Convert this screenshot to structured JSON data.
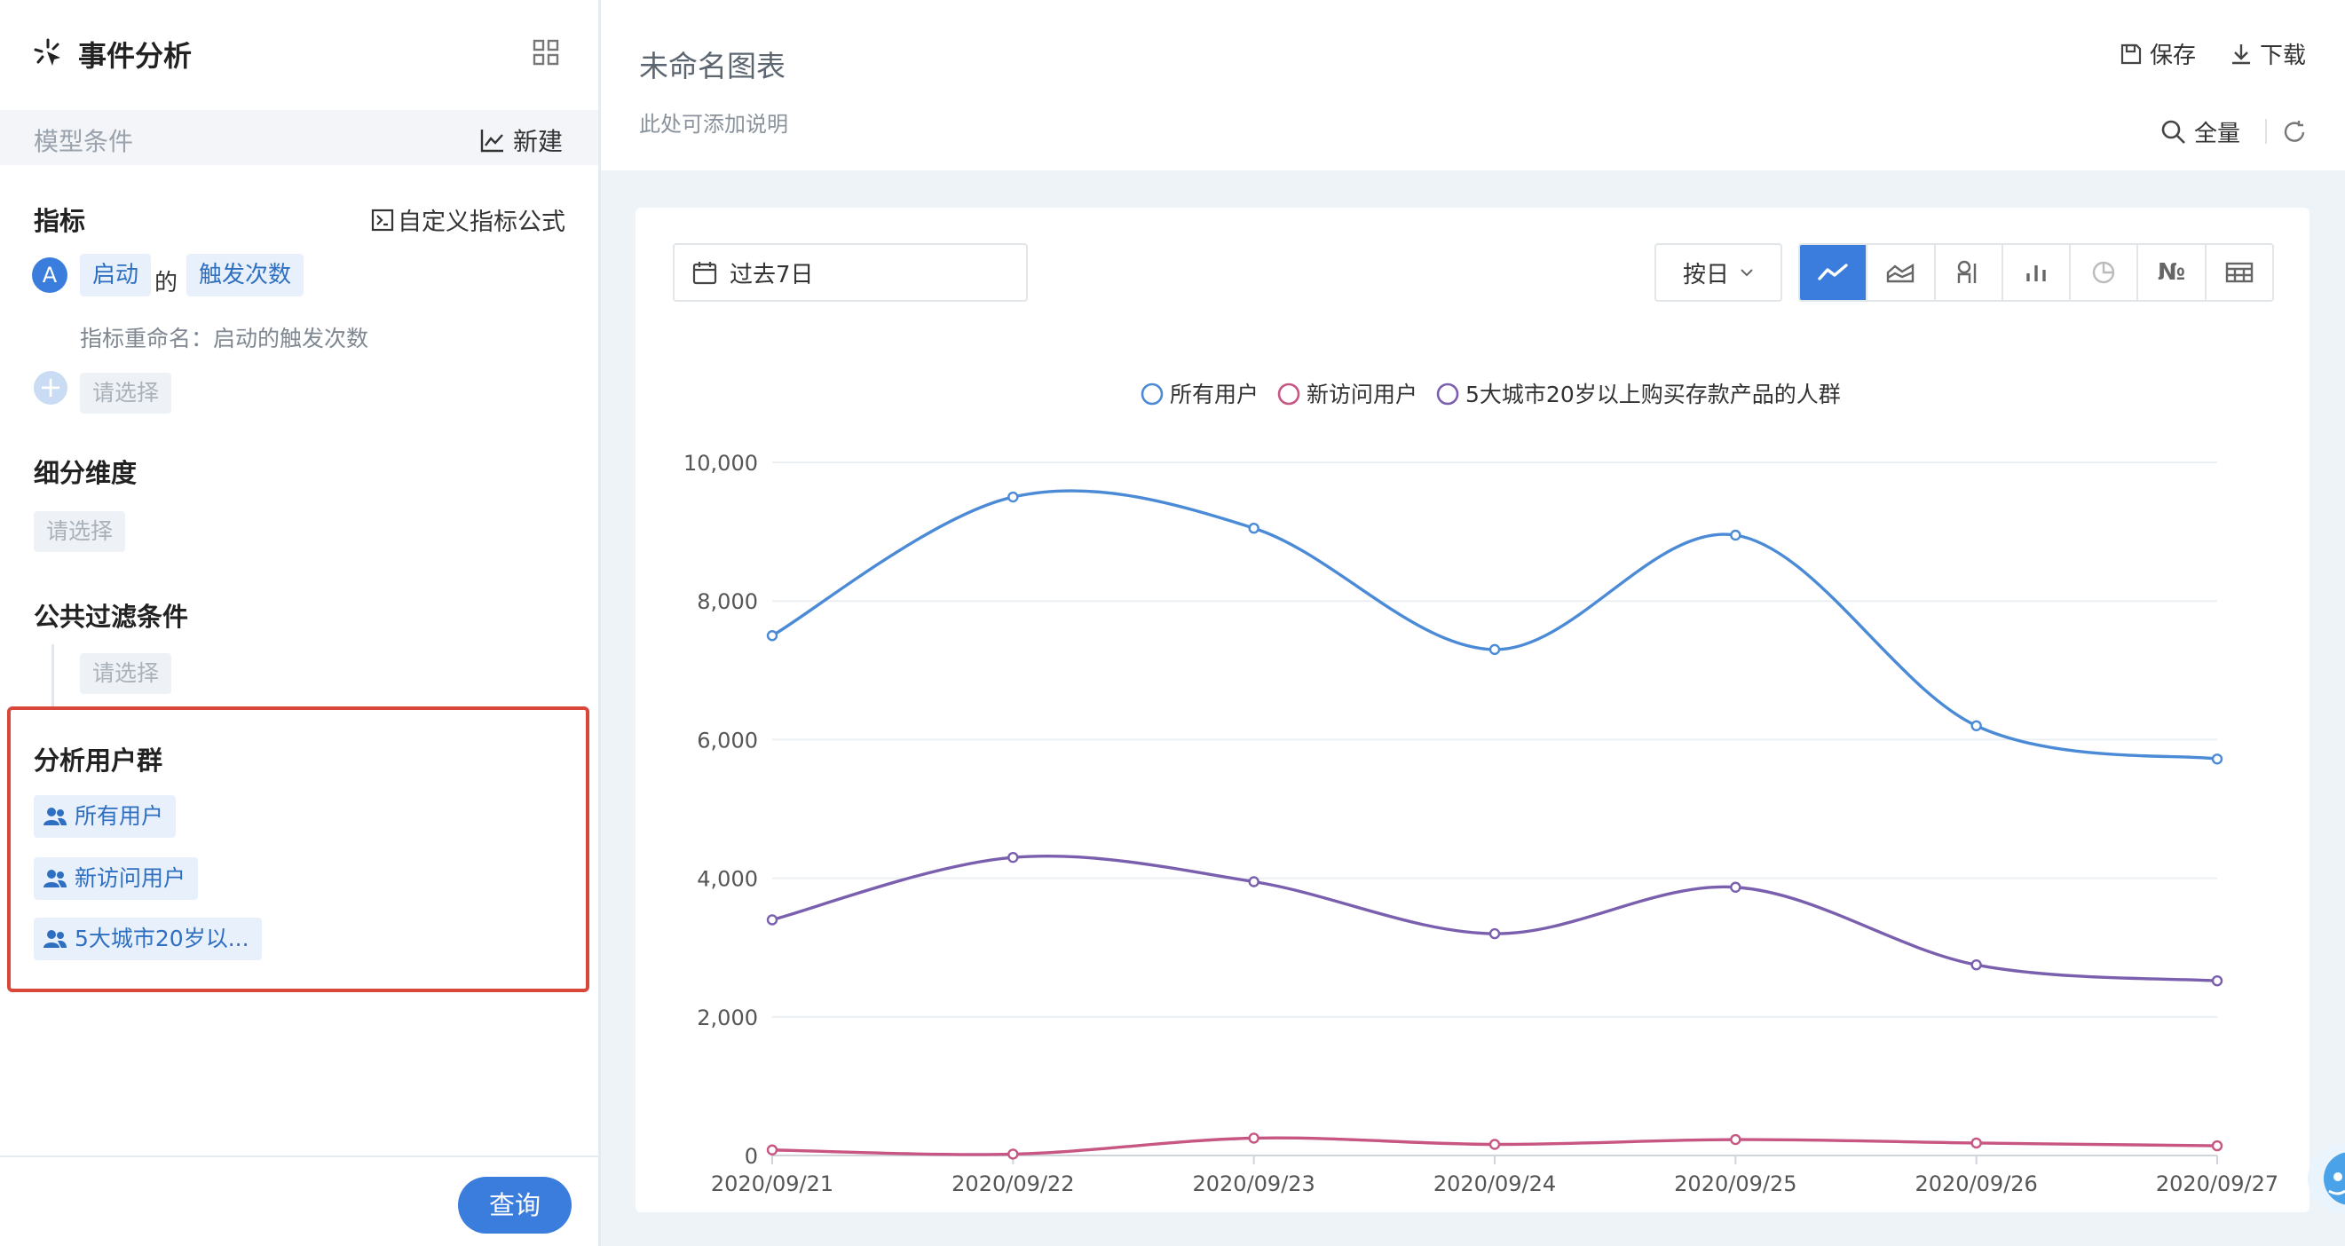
{
  "sidebar": {
    "title": "事件分析",
    "model_label": "模型条件",
    "new_label": "新建",
    "metric_section": "指标",
    "custom_formula": "自定义指标公式",
    "metric": {
      "badge": "A",
      "event": "启动",
      "connector": "的",
      "measure": "触发次数",
      "rename": "指标重命名：启动的触发次数"
    },
    "select_placeholder": "请选择",
    "dimension_section": "细分维度",
    "filter_section": "公共过滤条件",
    "user_group_section": "分析用户群",
    "user_groups": [
      "所有用户",
      "新访问用户",
      "5大城市20岁以..."
    ],
    "query_button": "查询"
  },
  "header": {
    "chart_name": "未命名图表",
    "description": "此处可添加说明",
    "save": "保存",
    "download": "下载",
    "fullscreen": "全量"
  },
  "toolbar": {
    "date_range": "过去7日",
    "granularity": "按日",
    "chart_types": [
      "line-chart-icon",
      "area-chart-icon",
      "funnel-icon",
      "bar-chart-icon",
      "pie-chart-icon",
      "number-icon",
      "table-icon"
    ],
    "number_type_label": "№"
  },
  "colors": {
    "accent": "#3b7ddd",
    "series_all": "#4a8ad6",
    "series_new": "#c75683",
    "series_city": "#7a5fae"
  },
  "chart_data": {
    "type": "line",
    "x": [
      "2020/09/21",
      "2020/09/22",
      "2020/09/23",
      "2020/09/24",
      "2020/09/25",
      "2020/09/26",
      "2020/09/27"
    ],
    "series": [
      {
        "name": "所有用户",
        "values": [
          7500,
          9500,
          9050,
          7300,
          8950,
          6200,
          5720
        ]
      },
      {
        "name": "新访问用户",
        "values": [
          80,
          20,
          250,
          160,
          230,
          180,
          140
        ]
      },
      {
        "name": "5大城市20岁以上购买存款产品的人群",
        "values": [
          3400,
          4300,
          3950,
          3200,
          3870,
          2750,
          2520
        ]
      }
    ],
    "yticks": [
      "0",
      "2,000",
      "4,000",
      "6,000",
      "8,000",
      "10,000"
    ],
    "ylim": [
      0,
      10000
    ],
    "grid": true,
    "legend": "top-center"
  }
}
